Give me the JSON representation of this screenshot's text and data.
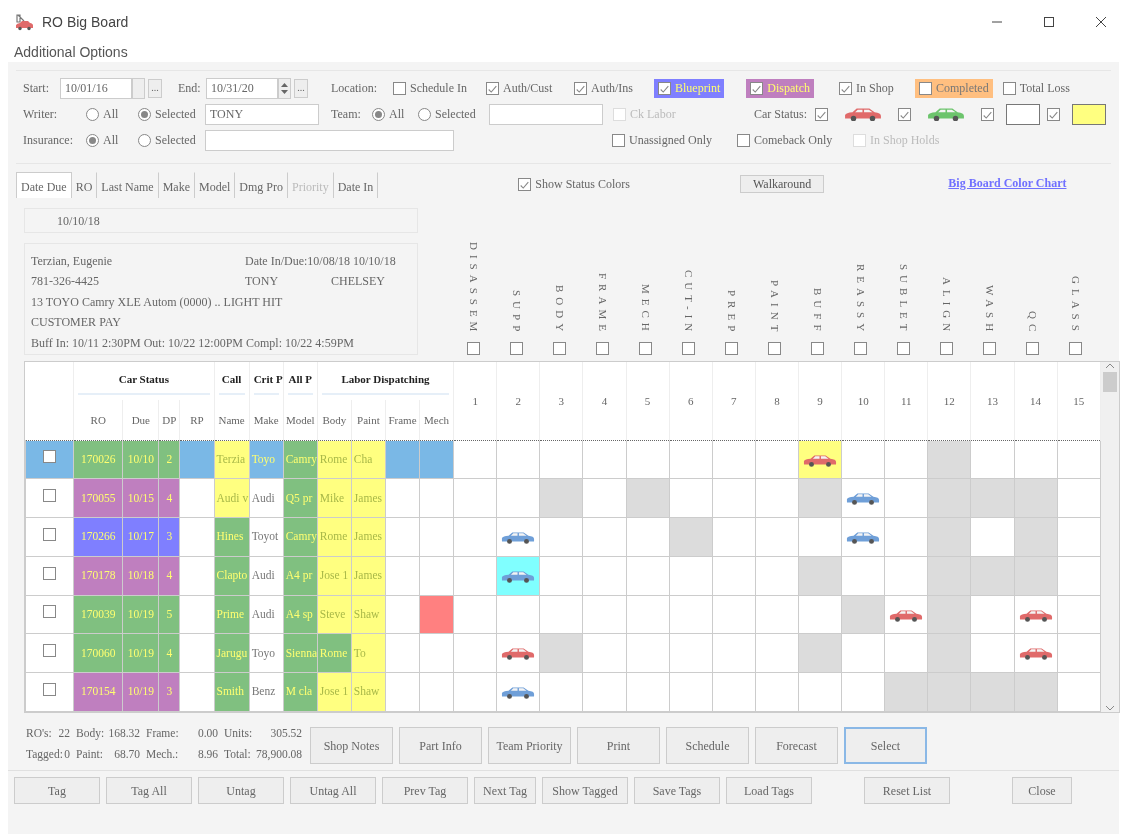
{
  "window": {
    "title": "RO Big Board"
  },
  "menu": [
    {
      "label": "Additional Options"
    }
  ],
  "filters": {
    "start": {
      "label": "Start:",
      "value": "10/01/16",
      "picker": "..."
    },
    "end": {
      "label": "End:",
      "value": "10/31/20",
      "picker": "..."
    },
    "location": {
      "label": "Location:",
      "options": [
        {
          "label": "Schedule In",
          "checked": false
        },
        {
          "label": "Auth/Cust",
          "checked": true
        },
        {
          "label": "Auth/Ins",
          "checked": true
        },
        {
          "label": "Blueprint",
          "checked": true,
          "color": "#7f7fff"
        },
        {
          "label": "Dispatch",
          "checked": true,
          "color": "#bf7fbf"
        },
        {
          "label": "In Shop",
          "checked": true
        },
        {
          "label": "Completed",
          "checked": false,
          "color": "#ffbf80"
        },
        {
          "label": "Total Loss",
          "checked": false
        }
      ]
    },
    "writer": {
      "label": "Writer:",
      "options": [
        {
          "label": "All",
          "selected": false
        },
        {
          "label": "Selected",
          "selected": true
        }
      ],
      "value": "TONY"
    },
    "team": {
      "label": "Team:",
      "options": [
        {
          "label": "All",
          "selected": true
        },
        {
          "label": "Selected",
          "selected": false
        }
      ]
    },
    "ck_labor": {
      "label": "Ck Labor",
      "checked": false,
      "disabled": true
    },
    "car_status": {
      "label": "Car Status:",
      "items": [
        {
          "kind": "car",
          "checked": true,
          "color": "#e06a6a"
        },
        {
          "kind": "car",
          "checked": true,
          "color": "#6cc46c"
        },
        {
          "kind": "swatch",
          "checked": true,
          "color": "#ffffff"
        },
        {
          "kind": "swatch",
          "checked": true,
          "color": "#ffff80"
        }
      ]
    },
    "insurance": {
      "label": "Insurance:",
      "options": [
        {
          "label": "All",
          "selected": true
        },
        {
          "label": "Selected",
          "selected": false
        }
      ]
    },
    "flags": [
      {
        "label": "Unassigned Only",
        "checked": false,
        "disabled": false
      },
      {
        "label": "Comeback Only",
        "checked": false,
        "disabled": false
      },
      {
        "label": "In Shop Holds",
        "checked": false,
        "disabled": true
      }
    ]
  },
  "sort_tabs": [
    {
      "label": "Date Due",
      "selected": true,
      "disabled": false
    },
    {
      "label": "RO",
      "selected": false,
      "disabled": false
    },
    {
      "label": "Last Name",
      "selected": false,
      "disabled": false
    },
    {
      "label": "Make",
      "selected": false,
      "disabled": false
    },
    {
      "label": "Model",
      "selected": false,
      "disabled": false
    },
    {
      "label": "Dmg Pro",
      "selected": false,
      "disabled": false
    },
    {
      "label": "Priority",
      "selected": false,
      "disabled": true
    },
    {
      "label": "Date In",
      "selected": false,
      "disabled": false
    }
  ],
  "show_status_colors": {
    "label": "Show Status Colors",
    "checked": true
  },
  "walkaround_button": "Walkaround",
  "color_chart_link": "Big Board Color Chart",
  "detail": {
    "date": "10/10/18",
    "lines": [
      [
        "Terzian, Eugenie",
        "Date In/Due:10/08/18   10/10/18"
      ],
      [
        "781-326-4425",
        "TONY",
        "CHELSEY"
      ],
      [
        "13 TOYO Camry XLE Autom (0000) .. LIGHT HIT"
      ],
      [
        "CUSTOMER PAY"
      ],
      [
        "Buff In: 10/11  2:30PM Out: 10/22 12:00PM Compl: 10/22  4:59PM"
      ]
    ]
  },
  "stages": [
    {
      "name": "DISASSEM",
      "checked": false
    },
    {
      "name": "SUPP",
      "checked": false
    },
    {
      "name": "BODY",
      "checked": false
    },
    {
      "name": "FRAME",
      "checked": false
    },
    {
      "name": "MECH",
      "checked": false
    },
    {
      "name": "CUT-IN",
      "checked": false
    },
    {
      "name": "PREP",
      "checked": false
    },
    {
      "name": "PAINT",
      "checked": false
    },
    {
      "name": "BUFF",
      "checked": false
    },
    {
      "name": "REASSY",
      "checked": false
    },
    {
      "name": "SUBLET",
      "checked": false
    },
    {
      "name": "ALIGN",
      "checked": false
    },
    {
      "name": "WASH",
      "checked": false
    },
    {
      "name": "QC",
      "checked": false
    },
    {
      "name": "GLASS",
      "checked": false
    }
  ],
  "table": {
    "groups": [
      {
        "label": "Car Status",
        "columns": [
          "RO",
          "Due",
          "DP",
          "RP"
        ]
      },
      {
        "label": "Call",
        "columns": [
          "Name"
        ]
      },
      {
        "label": "Crit P",
        "columns": [
          "Make"
        ]
      },
      {
        "label": "All P",
        "columns": [
          "Model"
        ]
      },
      {
        "label": "Labor Dispatching",
        "columns": [
          "Body",
          "Paint",
          "Frame",
          "Mech"
        ]
      }
    ],
    "stage_columns": [
      "1",
      "2",
      "3",
      "4",
      "5",
      "6",
      "7",
      "8",
      "9",
      "10",
      "11",
      "12",
      "13",
      "14",
      "15"
    ],
    "rows": [
      {
        "selected": true,
        "tagged": false,
        "cells": [
          {
            "text": "170026",
            "color": "#80c080"
          },
          {
            "text": "10/10",
            "color": "#80c080"
          },
          {
            "text": "2",
            "color": "#80c080"
          },
          {
            "color": "#7ab8e6"
          },
          {
            "text": "Terzia",
            "color": "#ffff80"
          },
          {
            "text": "Toyo",
            "color": "#7ab8e6"
          },
          {
            "text": "Camry",
            "color": "#80c080"
          },
          {
            "text": "Rome",
            "color": "#ffff80"
          },
          {
            "text": "Cha",
            "color": "#ffff80"
          },
          {
            "color": "#7ab8e6"
          },
          {
            "color": "#7ab8e6"
          }
        ],
        "stages": [
          {
            "color": "#ffffff"
          },
          {
            "color": "#ffffff"
          },
          {
            "color": "#ffffff"
          },
          {
            "color": "#ffffff"
          },
          {
            "color": "#ffffff"
          },
          {
            "color": "#ffffff"
          },
          {
            "color": "#ffffff"
          },
          {
            "color": "#ffffff"
          },
          {
            "color": "#ffff80",
            "car": {
              "color": "#e06a6a"
            }
          },
          {
            "color": "#ffffff"
          },
          {
            "color": "#ffffff"
          },
          {
            "color": "#dcdcdc"
          },
          {
            "color": "#ffffff"
          },
          {
            "color": "#ffffff"
          },
          {
            "color": "#ffffff"
          }
        ]
      },
      {
        "selected": false,
        "tagged": false,
        "cells": [
          {
            "text": "170055",
            "color": "#bf7fbf"
          },
          {
            "text": "10/15",
            "color": "#bf7fbf"
          },
          {
            "text": "4",
            "color": "#bf7fbf"
          },
          {
            "color": "#ffffff"
          },
          {
            "text": "Audi v",
            "color": "#ffff80"
          },
          {
            "text": "Audi",
            "color": "#ffffff"
          },
          {
            "text": "Q5 pr",
            "color": "#80c080"
          },
          {
            "text": "Mike",
            "color": "#ffff80"
          },
          {
            "text": "James",
            "color": "#ffff80"
          },
          {
            "color": "#ffffff"
          },
          {
            "color": "#ffffff"
          }
        ],
        "stages": [
          {
            "color": "#ffffff"
          },
          {
            "color": "#ffffff"
          },
          {
            "color": "#dcdcdc"
          },
          {
            "color": "#ffffff"
          },
          {
            "color": "#dcdcdc"
          },
          {
            "color": "#ffffff"
          },
          {
            "color": "#ffffff"
          },
          {
            "color": "#ffffff"
          },
          {
            "color": "#dcdcdc"
          },
          {
            "color": "#ffffff",
            "car": {
              "color": "#6f9fd8"
            }
          },
          {
            "color": "#ffffff"
          },
          {
            "color": "#dcdcdc"
          },
          {
            "color": "#dcdcdc"
          },
          {
            "color": "#dcdcdc"
          },
          {
            "color": "#ffffff"
          }
        ]
      },
      {
        "selected": false,
        "tagged": false,
        "cells": [
          {
            "text": "170266",
            "color": "#7f7fff"
          },
          {
            "text": "10/17",
            "color": "#7f7fff"
          },
          {
            "text": "3",
            "color": "#7f7fff"
          },
          {
            "color": "#ffffff"
          },
          {
            "text": "Hines",
            "color": "#80c080"
          },
          {
            "text": "Toyot",
            "color": "#ffffff"
          },
          {
            "text": "Camry",
            "color": "#80c080"
          },
          {
            "text": "Rome",
            "color": "#ffff80"
          },
          {
            "text": "James",
            "color": "#ffff80"
          },
          {
            "color": "#ffffff"
          },
          {
            "color": "#ffffff"
          }
        ],
        "stages": [
          {
            "color": "#ffffff"
          },
          {
            "color": "#ffffff",
            "car": {
              "color": "#6f9fd8"
            }
          },
          {
            "color": "#ffffff"
          },
          {
            "color": "#ffffff"
          },
          {
            "color": "#ffffff"
          },
          {
            "color": "#dcdcdc"
          },
          {
            "color": "#ffffff"
          },
          {
            "color": "#ffffff"
          },
          {
            "color": "#ffffff"
          },
          {
            "color": "#ffffff",
            "car": {
              "color": "#6f9fd8"
            }
          },
          {
            "color": "#ffffff"
          },
          {
            "color": "#dcdcdc"
          },
          {
            "color": "#ffffff"
          },
          {
            "color": "#dcdcdc"
          },
          {
            "color": "#ffffff"
          }
        ]
      },
      {
        "selected": false,
        "tagged": false,
        "cells": [
          {
            "text": "170178",
            "color": "#bf7fbf"
          },
          {
            "text": "10/18",
            "color": "#bf7fbf"
          },
          {
            "text": "4",
            "color": "#bf7fbf"
          },
          {
            "color": "#ffffff"
          },
          {
            "text": "Clapto",
            "color": "#80c080"
          },
          {
            "text": "Audi",
            "color": "#ffffff"
          },
          {
            "text": "A4 pr",
            "color": "#80c080"
          },
          {
            "text": "Jose 1",
            "color": "#ffff80"
          },
          {
            "text": "James",
            "color": "#ffff80"
          },
          {
            "color": "#ffffff"
          },
          {
            "color": "#ffffff"
          }
        ],
        "stages": [
          {
            "color": "#ffffff"
          },
          {
            "color": "#80ffff",
            "car": {
              "color": "#6f9fd8"
            }
          },
          {
            "color": "#ffffff"
          },
          {
            "color": "#ffffff"
          },
          {
            "color": "#ffffff"
          },
          {
            "color": "#ffffff"
          },
          {
            "color": "#ffffff"
          },
          {
            "color": "#ffffff"
          },
          {
            "color": "#dcdcdc"
          },
          {
            "color": "#ffffff"
          },
          {
            "color": "#ffffff"
          },
          {
            "color": "#dcdcdc"
          },
          {
            "color": "#dcdcdc"
          },
          {
            "color": "#dcdcdc"
          },
          {
            "color": "#ffffff"
          }
        ]
      },
      {
        "selected": false,
        "tagged": false,
        "cells": [
          {
            "text": "170039",
            "color": "#80c080"
          },
          {
            "text": "10/19",
            "color": "#80c080"
          },
          {
            "text": "5",
            "color": "#80c080"
          },
          {
            "color": "#ffffff"
          },
          {
            "text": "Prime",
            "color": "#80c080"
          },
          {
            "text": "Audi",
            "color": "#ffffff"
          },
          {
            "text": "A4 sp",
            "color": "#80c080"
          },
          {
            "text": "Steve",
            "color": "#ffff80"
          },
          {
            "text": "Shaw",
            "color": "#ffff80"
          },
          {
            "color": "#ffffff"
          },
          {
            "color": "#ff8080"
          }
        ],
        "stages": [
          {
            "color": "#ffffff"
          },
          {
            "color": "#ffffff"
          },
          {
            "color": "#ffffff"
          },
          {
            "color": "#ffffff"
          },
          {
            "color": "#ffffff"
          },
          {
            "color": "#ffffff"
          },
          {
            "color": "#ffffff"
          },
          {
            "color": "#ffffff"
          },
          {
            "color": "#ffffff"
          },
          {
            "color": "#dcdcdc"
          },
          {
            "color": "#ffffff",
            "car": {
              "color": "#e06a6a"
            }
          },
          {
            "color": "#dcdcdc"
          },
          {
            "color": "#ffffff"
          },
          {
            "color": "#ffffff",
            "car": {
              "color": "#e06a6a"
            }
          },
          {
            "color": "#ffffff"
          }
        ]
      },
      {
        "selected": false,
        "tagged": false,
        "cells": [
          {
            "text": "170060",
            "color": "#80c080"
          },
          {
            "text": "10/19",
            "color": "#80c080"
          },
          {
            "text": "4",
            "color": "#80c080"
          },
          {
            "color": "#ffffff"
          },
          {
            "text": "Jarugu",
            "color": "#80c080"
          },
          {
            "text": "Toyo",
            "color": "#ffffff"
          },
          {
            "text": "Sienna",
            "color": "#80c080"
          },
          {
            "text": "Rome",
            "color": "#80c080"
          },
          {
            "text": "To",
            "color": "#ffff80"
          },
          {
            "color": "#ffffff"
          },
          {
            "color": "#ffffff"
          }
        ],
        "stages": [
          {
            "color": "#ffffff"
          },
          {
            "color": "#ffffff",
            "car": {
              "color": "#e06a6a"
            }
          },
          {
            "color": "#dcdcdc"
          },
          {
            "color": "#ffffff"
          },
          {
            "color": "#ffffff"
          },
          {
            "color": "#ffffff"
          },
          {
            "color": "#ffffff"
          },
          {
            "color": "#ffffff"
          },
          {
            "color": "#dcdcdc"
          },
          {
            "color": "#ffffff"
          },
          {
            "color": "#ffffff"
          },
          {
            "color": "#dcdcdc"
          },
          {
            "color": "#ffffff"
          },
          {
            "color": "#ffffff",
            "car": {
              "color": "#e06a6a"
            }
          },
          {
            "color": "#ffffff"
          }
        ]
      },
      {
        "selected": false,
        "tagged": false,
        "cells": [
          {
            "text": "170154",
            "color": "#bf7fbf"
          },
          {
            "text": "10/19",
            "color": "#bf7fbf"
          },
          {
            "text": "3",
            "color": "#bf7fbf"
          },
          {
            "color": "#ffffff"
          },
          {
            "text": "Smith",
            "color": "#80c080"
          },
          {
            "text": "Benz",
            "color": "#ffffff"
          },
          {
            "text": "M cla",
            "color": "#80c080"
          },
          {
            "text": "Jose 1",
            "color": "#ffff80"
          },
          {
            "text": "Shaw",
            "color": "#ffff80"
          },
          {
            "color": "#ffffff"
          },
          {
            "color": "#ffffff"
          }
        ],
        "stages": [
          {
            "color": "#ffffff"
          },
          {
            "color": "#ffffff",
            "car": {
              "color": "#6f9fd8"
            }
          },
          {
            "color": "#ffffff"
          },
          {
            "color": "#ffffff"
          },
          {
            "color": "#ffffff"
          },
          {
            "color": "#ffffff"
          },
          {
            "color": "#ffffff"
          },
          {
            "color": "#ffffff"
          },
          {
            "color": "#ffffff"
          },
          {
            "color": "#ffffff"
          },
          {
            "color": "#dcdcdc"
          },
          {
            "color": "#dcdcdc"
          },
          {
            "color": "#dcdcdc"
          },
          {
            "color": "#dcdcdc"
          },
          {
            "color": "#ffffff"
          }
        ]
      }
    ]
  },
  "totals": [
    [
      {
        "label": "RO's:",
        "value": "22"
      },
      {
        "label": "Body:",
        "value": "168.32"
      },
      {
        "label": "Frame:",
        "value": "0.00"
      },
      {
        "label": "Units:",
        "value": "305.52"
      }
    ],
    [
      {
        "label": "Tagged:",
        "value": "0"
      },
      {
        "label": "Paint:",
        "value": "68.70"
      },
      {
        "label": "Mech.:",
        "value": "8.96"
      },
      {
        "label": "Total:",
        "value": "78,900.08"
      }
    ]
  ],
  "actions": [
    {
      "label": "Shop Notes",
      "focused": false
    },
    {
      "label": "Part Info",
      "focused": false
    },
    {
      "label": "Team Priority",
      "focused": false
    },
    {
      "label": "Print",
      "focused": false
    },
    {
      "label": "Schedule",
      "focused": false
    },
    {
      "label": "Forecast",
      "focused": false
    },
    {
      "label": "Select",
      "focused": true
    }
  ],
  "tag_buttons": [
    "Tag",
    "Tag All",
    "Untag",
    "Untag All",
    "Prev Tag",
    "Next Tag",
    "Show Tagged",
    "Save Tags",
    "Load Tags"
  ],
  "reset_button": "Reset List",
  "close_button": "Close"
}
